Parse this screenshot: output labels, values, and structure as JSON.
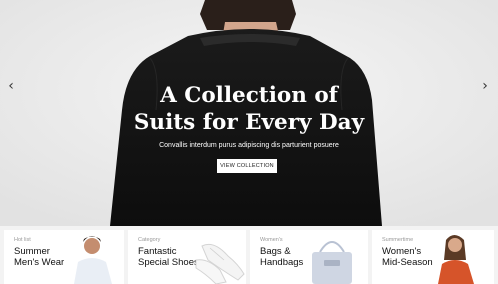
{
  "hero": {
    "title_line1": "A Collection of",
    "title_line2": "Suits for Every Day",
    "subtitle": "Convallis interdum purus adipiscing dis parturient posuere",
    "button_label": "VIEW COLLECTION",
    "prev_icon": "chevron-left-icon",
    "next_icon": "chevron-right-icon"
  },
  "cards": [
    {
      "kicker": "Hot list",
      "title_line1": "Summer",
      "title_line2": "Men's Wear"
    },
    {
      "kicker": "Category",
      "title_line1": "Fantastic",
      "title_line2": "Special Shoes"
    },
    {
      "kicker": "Women's",
      "title_line1": "Bags &",
      "title_line2": "Handbags"
    },
    {
      "kicker": "Summertime",
      "title_line1": "Women's",
      "title_line2": "Mid-Season"
    }
  ]
}
